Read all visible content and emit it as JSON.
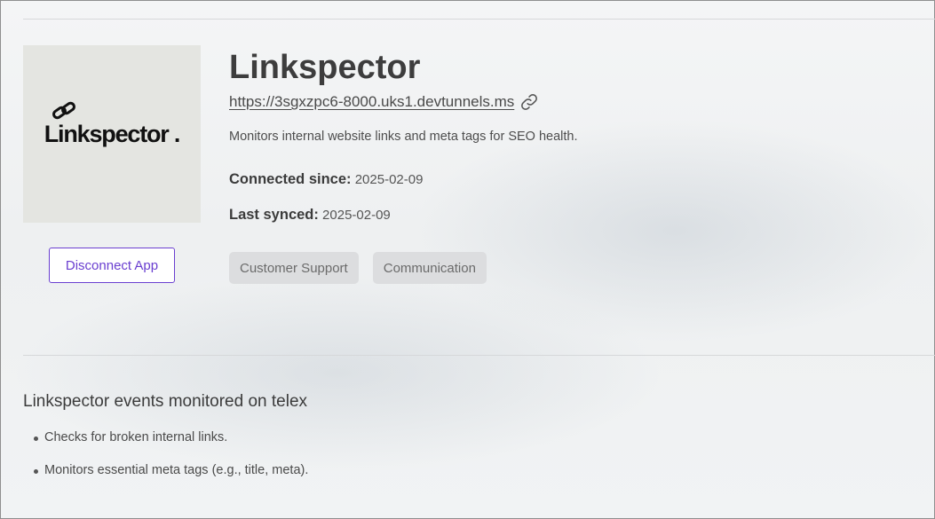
{
  "app": {
    "logo_text": "Linkspector",
    "logo_dot": ".",
    "title": "Linkspector",
    "url": "https://3sgxzpc6-8000.uks1.devtunnels.ms",
    "description": "Monitors internal website links and meta tags for SEO health.",
    "connected_since_label": "Connected since:",
    "connected_since_value": "2025-02-09",
    "last_synced_label": "Last synced:",
    "last_synced_value": "2025-02-09",
    "disconnect_label": "Disconnect App",
    "tags": [
      "Customer Support",
      "Communication"
    ]
  },
  "icons": {
    "url_link": "link-icon",
    "logo_link": "chain-link-icon"
  },
  "colors": {
    "accent": "#6a3fd0",
    "tag_bg": "#dcdddf",
    "logo_bg": "#e4e5e1"
  },
  "events": {
    "title": "Linkspector events monitored on telex",
    "items": [
      "Checks for broken internal links.",
      "Monitors essential meta tags (e.g., title, meta)."
    ]
  }
}
